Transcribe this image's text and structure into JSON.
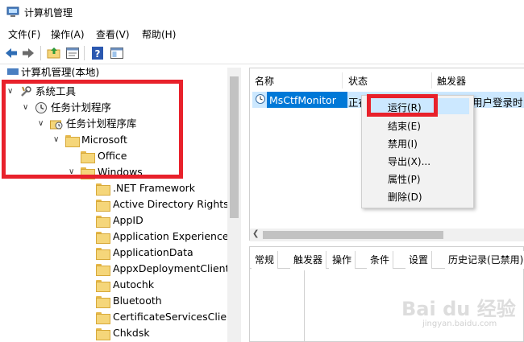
{
  "window": {
    "title": "计算机管理"
  },
  "menubar": {
    "items": [
      "文件(F)",
      "操作(A)",
      "查看(V)",
      "帮助(H)"
    ]
  },
  "toolbar": {
    "buttons": [
      "back-arrow-icon",
      "forward-arrow-icon",
      "up-folder-icon",
      "properties-icon",
      "help-icon",
      "show-pane-icon"
    ]
  },
  "tree": {
    "root": "计算机管理(本地)",
    "items": [
      {
        "label": "系统工具",
        "icon": "tools-icon",
        "expanded": true
      },
      {
        "label": "任务计划程序",
        "icon": "clock-icon",
        "expanded": true
      },
      {
        "label": "任务计划程序库",
        "icon": "clock-folder-icon",
        "expanded": true
      },
      {
        "label": "Microsoft",
        "icon": "folder-icon",
        "expanded": true
      },
      {
        "label": "Office",
        "icon": "folder-icon",
        "expanded": false
      },
      {
        "label": "Windows",
        "icon": "folder-icon",
        "expanded": true
      },
      {
        "label": ".NET Framework",
        "icon": "folder-icon"
      },
      {
        "label": "Active Directory Rights M",
        "icon": "folder-icon"
      },
      {
        "label": "AppID",
        "icon": "folder-icon"
      },
      {
        "label": "Application Experience",
        "icon": "folder-icon"
      },
      {
        "label": "ApplicationData",
        "icon": "folder-icon"
      },
      {
        "label": "AppxDeploymentClient",
        "icon": "folder-icon"
      },
      {
        "label": "Autochk",
        "icon": "folder-icon"
      },
      {
        "label": "Bluetooth",
        "icon": "folder-icon"
      },
      {
        "label": "CertificateServicesClient",
        "icon": "folder-icon"
      },
      {
        "label": "Chkdsk",
        "icon": "folder-icon"
      }
    ]
  },
  "task_list": {
    "columns": [
      "名称",
      "状态",
      "触发器"
    ],
    "rows": [
      {
        "name": "MsCtfMonitor",
        "status": "正在",
        "trigger": "用户登录时"
      }
    ]
  },
  "context_menu": {
    "items": [
      "运行(R)",
      "结束(E)",
      "禁用(I)",
      "导出(X)...",
      "属性(P)",
      "删除(D)"
    ]
  },
  "details_tabs": [
    "常规",
    "触发器",
    "操作",
    "条件",
    "设置",
    "历史记录(已禁用)"
  ],
  "watermark": {
    "text": "Bai du 经验",
    "sub": "jingyan.baidu.com"
  },
  "colors": {
    "highlight_frame": "#e8212b",
    "selection": "#0078d7",
    "hover": "#cce8ff"
  }
}
